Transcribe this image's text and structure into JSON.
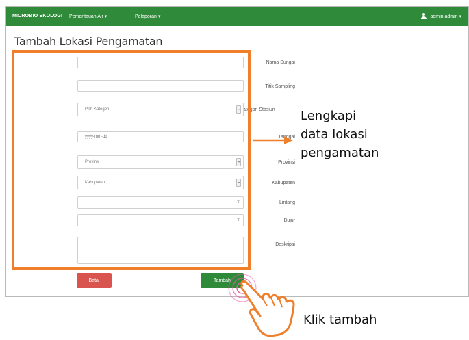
{
  "navbar": {
    "brand": "MICROBIO EKOLOGI",
    "menu1": "Pemantauan Air ▾",
    "menu2": "Pelaporan ▾",
    "user": "admin admin ▾"
  },
  "page_title": "Tambah Lokasi Pengamatan",
  "form": {
    "fields": [
      {
        "label": "Nama Sungai",
        "value": ""
      },
      {
        "label": "Titik Sampling",
        "value": ""
      },
      {
        "label": "Kategori Stasiun",
        "value": "Pilih Kategori"
      },
      {
        "label": "Tanggal",
        "value": "yyyy-mm-dd"
      },
      {
        "label": "Provinsi",
        "value": "Provinsi"
      },
      {
        "label": "Kabupaten",
        "value": "Kabupaten"
      },
      {
        "label": "Lintang",
        "value": ""
      },
      {
        "label": "Bujur",
        "value": ""
      },
      {
        "label": "Deskripsi",
        "value": ""
      }
    ],
    "batal_label": "Batal",
    "tambah_label": "Tambah"
  },
  "annotations": {
    "line1": "Lengkapi",
    "line2": "data lokasi",
    "line3": "pengamatan",
    "click": "Klik tambah"
  },
  "colors": {
    "navbar": "#2f8a3a",
    "highlight": "#ef7f2b",
    "batal": "#d9534f",
    "tambah": "#2f8a3a"
  }
}
